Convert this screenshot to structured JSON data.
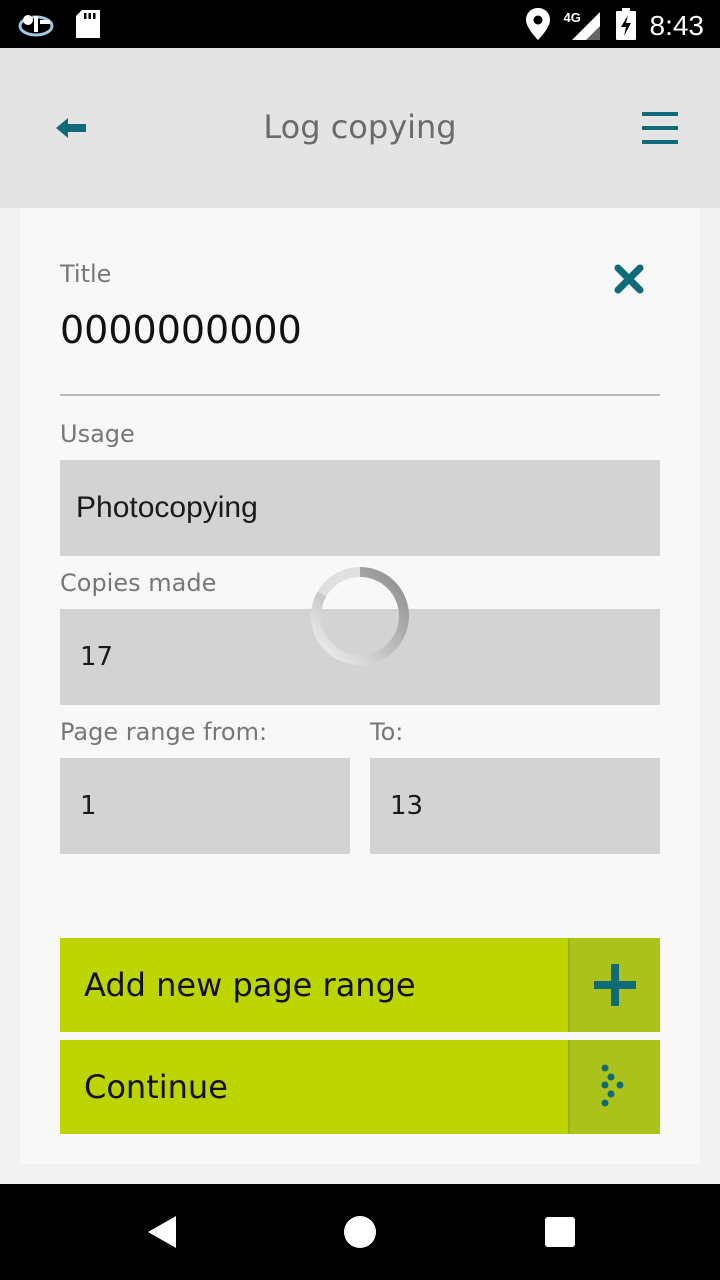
{
  "status_bar": {
    "time": "8:43",
    "network": "4G",
    "icons": [
      "app-notification-icon",
      "sd-card-icon",
      "location-icon",
      "signal-icon",
      "battery-charging-icon"
    ]
  },
  "app_bar": {
    "title": "Log copying",
    "back_icon": "back-arrow-icon",
    "menu_icon": "hamburger-menu-icon"
  },
  "form": {
    "title": {
      "label": "Title",
      "value": "0000000000"
    },
    "usage": {
      "label": "Usage",
      "value": "Photocopying"
    },
    "copies": {
      "label": "Copies made",
      "value": "17"
    },
    "page_range": {
      "from_label": "Page range from:",
      "from_value": "1",
      "to_label": "To:",
      "to_value": "13"
    }
  },
  "buttons": {
    "add_range": "Add new page range",
    "continue": "Continue"
  },
  "colors": {
    "accent": "#0f6b78",
    "button": "#bcd400",
    "button_icon_bg": "#abc21a"
  }
}
